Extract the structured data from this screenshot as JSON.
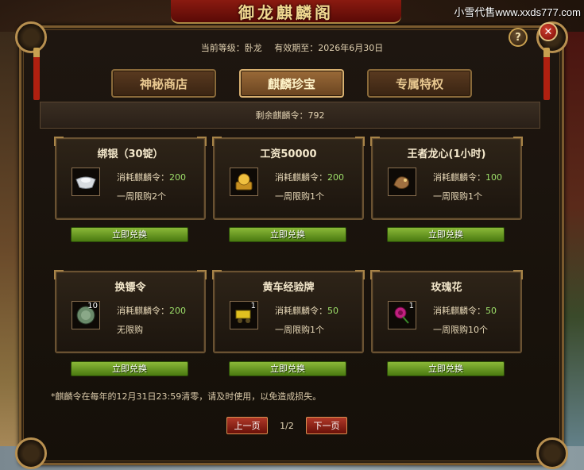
{
  "banner": {
    "title": "御龙麒麟阁"
  },
  "watermark": "小雪代售www.xxds777.com",
  "header": {
    "level_label": "当前等级：卧龙",
    "expiry_label": "有效期至：2026年6月30日",
    "help": "?",
    "close": "✕"
  },
  "tabs": [
    {
      "label": "神秘商店"
    },
    {
      "label": "麒麟珍宝"
    },
    {
      "label": "专属特权"
    }
  ],
  "remain": {
    "label": "剩余麒麟令：792"
  },
  "items": [
    {
      "title": "绑银（30锭）",
      "cost_label": "消耗麒麟令：",
      "cost": "200",
      "limit": "一周限购2个",
      "qty": "",
      "icon": "silver-ingot-icon",
      "button": "立即兑换"
    },
    {
      "title": "工资50000",
      "cost_label": "消耗麒麟令：",
      "cost": "200",
      "limit": "一周限购1个",
      "qty": "",
      "icon": "gold-pouch-icon",
      "button": "立即兑换"
    },
    {
      "title": "王者龙心(1小时)",
      "cost_label": "消耗麒麟令：",
      "cost": "100",
      "limit": "一周限购1个",
      "qty": "",
      "icon": "dragon-heart-icon",
      "button": "立即兑换"
    },
    {
      "title": "换镖令",
      "cost_label": "消耗麒麟令：",
      "cost": "200",
      "limit": "无限购",
      "qty": "10",
      "icon": "escort-token-icon",
      "button": "立即兑换"
    },
    {
      "title": "黄车经验牌",
      "cost_label": "消耗麒麟令：",
      "cost": "50",
      "limit": "一周限购1个",
      "qty": "1",
      "icon": "yellow-cart-icon",
      "button": "立即兑换"
    },
    {
      "title": "玫瑰花",
      "cost_label": "消耗麒麟令：",
      "cost": "50",
      "limit": "一周限购10个",
      "qty": "1",
      "icon": "rose-icon",
      "button": "立即兑换"
    }
  ],
  "note": "*麒麟令在每年的12月31日23:59清零，请及时使用，以免造成损失。",
  "pager": {
    "prev": "上一页",
    "page": "1/2",
    "next": "下一页"
  },
  "colors": {
    "accent_gold": "#c8a050",
    "cost_green": "#9ee06a",
    "button_green": "#6a9a20",
    "pager_red": "#a02818"
  }
}
